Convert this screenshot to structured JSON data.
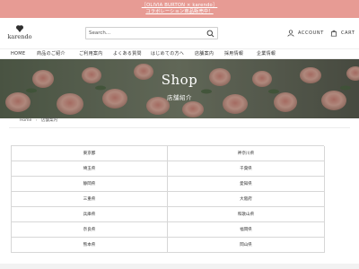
{
  "announcement": {
    "line1": "［OLIVIA BURTON × karendo］",
    "line2": "コラボレーション商品販売中！"
  },
  "brand": {
    "name": "karendo"
  },
  "search": {
    "placeholder": "Search..."
  },
  "header_actions": {
    "account": "ACCOUNT",
    "cart": "CART"
  },
  "nav": {
    "items": [
      {
        "label": "HOME"
      },
      {
        "label": "商品のご紹介"
      },
      {
        "label": "ご利用案内"
      },
      {
        "label": "よくある質問"
      },
      {
        "label": "はじめての方へ"
      },
      {
        "label": "店舗案内"
      },
      {
        "label": "採用情報"
      },
      {
        "label": "企業情報"
      }
    ]
  },
  "hero": {
    "title": "Shop",
    "subtitle": "店舗紹介"
  },
  "breadcrumb": {
    "home": "Home",
    "current": "店舗案内"
  },
  "stores": [
    [
      "東京都",
      "神奈川県"
    ],
    [
      "埼玉県",
      "千葉県"
    ],
    [
      "静岡県",
      "愛知県"
    ],
    [
      "三重県",
      "大阪府"
    ],
    [
      "兵庫県",
      "和歌山県"
    ],
    [
      "奈良県",
      "福岡県"
    ],
    [
      "熊本県",
      "岡山県"
    ]
  ],
  "colors": {
    "announcement_bg": "#e79b94",
    "hero_overlay": "#5c6356"
  }
}
